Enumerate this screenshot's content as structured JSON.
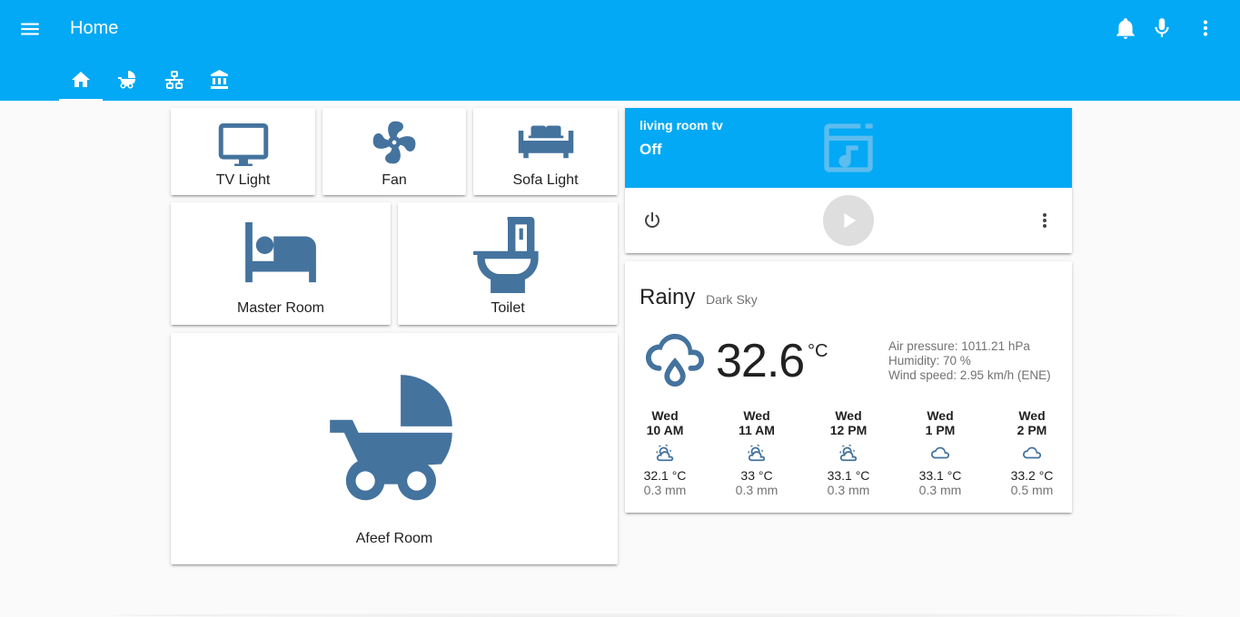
{
  "app": {
    "title": "Home"
  },
  "header": {
    "actions": [
      {
        "icon": "bell-icon"
      },
      {
        "icon": "microphone-icon"
      },
      {
        "icon": "more-vert-icon"
      }
    ]
  },
  "tabs": [
    {
      "icon": "home-icon",
      "active": true
    },
    {
      "icon": "stroller-icon",
      "active": false
    },
    {
      "icon": "network-icon",
      "active": false
    },
    {
      "icon": "bank-icon",
      "active": false
    }
  ],
  "entities": {
    "tv_light": "TV Light",
    "fan": "Fan",
    "sofa_light": "Sofa Light",
    "master_room": "Master Room",
    "toilet": "Toilet",
    "afeef_room": "Afeef Room"
  },
  "media": {
    "name": "living room tv",
    "state": "Off"
  },
  "weather": {
    "state": "Rainy",
    "source": "Dark Sky",
    "temperature": "32.6",
    "unit": "°C",
    "air_pressure": "Air pressure: 1011.21 hPa",
    "humidity": "Humidity: 70 %",
    "wind_speed": "Wind speed: 2.95 km/h (ENE)",
    "forecast": [
      {
        "day": "Wed",
        "time": "10 AM",
        "icon": "partly-cloudy-icon",
        "temp": "32.1 °C",
        "precip": "0.3 mm"
      },
      {
        "day": "Wed",
        "time": "11 AM",
        "icon": "partly-cloudy-icon",
        "temp": "33 °C",
        "precip": "0.3 mm"
      },
      {
        "day": "Wed",
        "time": "12 PM",
        "icon": "partly-cloudy-icon",
        "temp": "33.1 °C",
        "precip": "0.3 mm"
      },
      {
        "day": "Wed",
        "time": "1 PM",
        "icon": "cloudy-icon",
        "temp": "33.1 °C",
        "precip": "0.3 mm"
      },
      {
        "day": "Wed",
        "time": "2 PM",
        "icon": "cloudy-icon",
        "temp": "33.2 °C",
        "precip": "0.5 mm"
      }
    ]
  },
  "colors": {
    "primary": "#03a9f4",
    "icon_blue": "#44739e",
    "background": "#fafafa"
  }
}
